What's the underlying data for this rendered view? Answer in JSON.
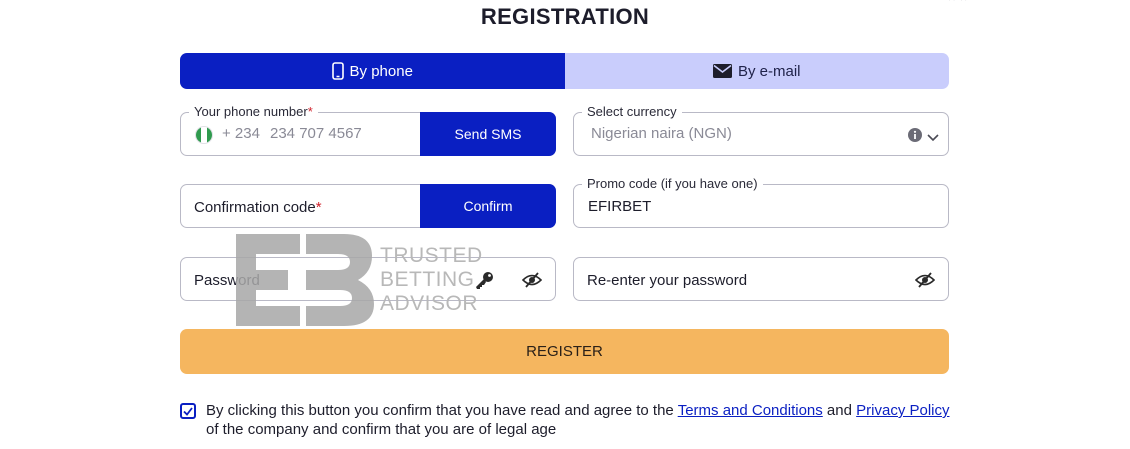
{
  "page": {
    "title": "REGISTRATION"
  },
  "tabs": [
    {
      "label": "By phone",
      "icon": "smartphone-icon",
      "active": true
    },
    {
      "label": "By e-mail",
      "icon": "envelope-icon",
      "active": false
    }
  ],
  "phone": {
    "label": "Your phone number",
    "required_mark": "*",
    "country_code": "+ 234",
    "placeholder": "234 707 4567",
    "flag_icon": "nigeria-flag-icon",
    "send_button": "Send SMS"
  },
  "currency": {
    "label": "Select currency",
    "value": "Nigerian naira (NGN)",
    "info_icon": "info-icon",
    "chevron_icon": "chevron-down-icon"
  },
  "confirmation": {
    "label": "Confirmation code",
    "required_mark": "*",
    "button": "Confirm"
  },
  "promo": {
    "label": "Promo code (if you have one)",
    "value": "EFIRBET"
  },
  "password": {
    "label": "Password",
    "toggle_icon": "eye-slash-icon"
  },
  "reenter_password": {
    "label": "Re-enter your password",
    "toggle_icon": "eye-slash-icon"
  },
  "register": {
    "label": "REGISTER"
  },
  "consent": {
    "checked": true,
    "text_before": "By clicking this button you confirm that you have read and agree to the ",
    "terms_link": "Terms and Conditions",
    "text_and": " and ",
    "privacy_link": "Privacy Policy",
    "text_after": " of the company and confirm that you are of legal age"
  },
  "watermark": {
    "lines": [
      "TRUSTED",
      "BETTING",
      "ADVISOR"
    ]
  },
  "colors": {
    "primary": "#0a1fc2",
    "tab_inactive": "#c9cdfc",
    "register": "#f5b65f",
    "required": "#d0202a"
  }
}
